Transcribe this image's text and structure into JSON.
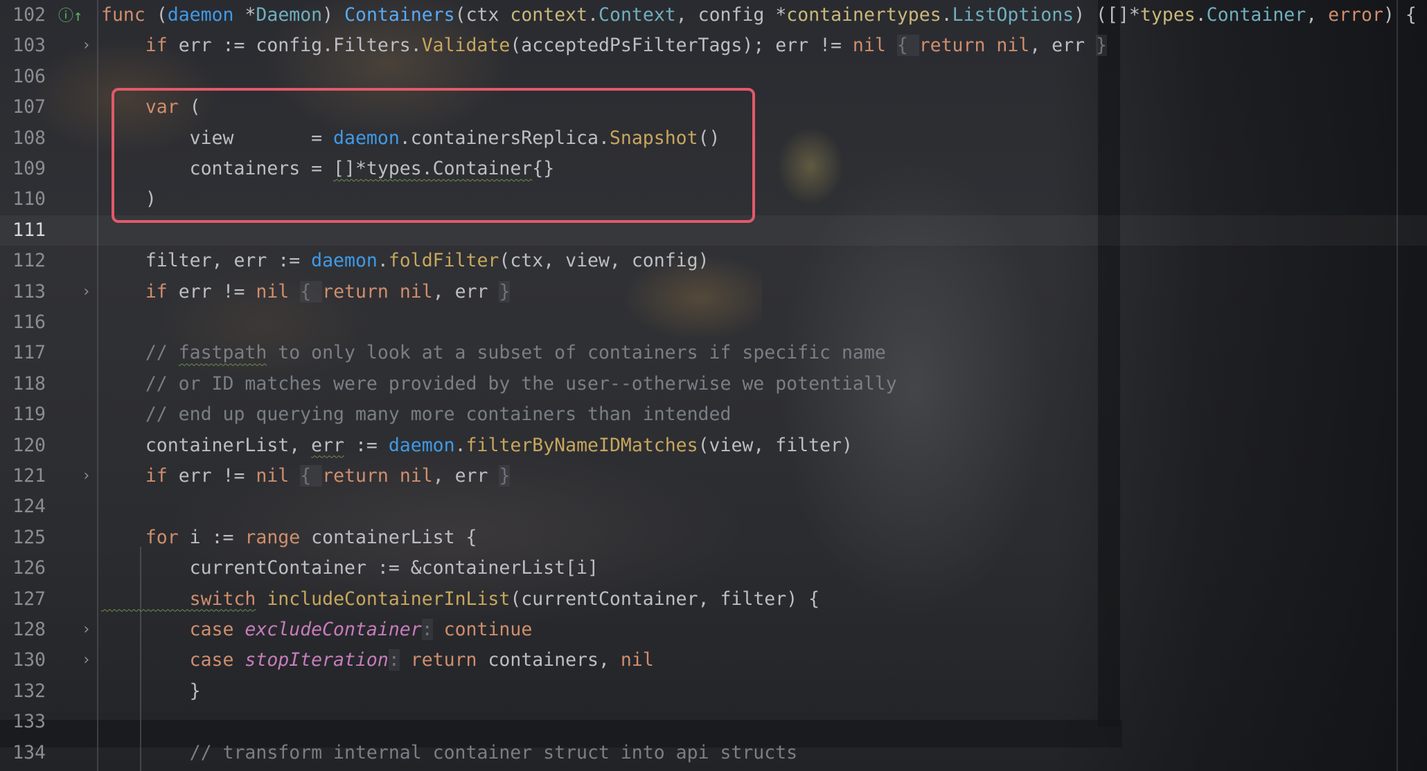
{
  "editor": {
    "language": "Go",
    "highlight_color": "#e15a6a",
    "gutter_icon": "implements-interface-icon",
    "lines": [
      {
        "number": "102",
        "current": false,
        "fold": false,
        "icon": true
      },
      {
        "number": "103",
        "current": false,
        "fold": true
      },
      {
        "number": "106",
        "current": false,
        "fold": false
      },
      {
        "number": "107",
        "current": false,
        "fold": false
      },
      {
        "number": "108",
        "current": false,
        "fold": false
      },
      {
        "number": "109",
        "current": false,
        "fold": false
      },
      {
        "number": "110",
        "current": false,
        "fold": false
      },
      {
        "number": "111",
        "current": true,
        "fold": false
      },
      {
        "number": "112",
        "current": false,
        "fold": false
      },
      {
        "number": "113",
        "current": false,
        "fold": true
      },
      {
        "number": "116",
        "current": false,
        "fold": false
      },
      {
        "number": "117",
        "current": false,
        "fold": false
      },
      {
        "number": "118",
        "current": false,
        "fold": false
      },
      {
        "number": "119",
        "current": false,
        "fold": false
      },
      {
        "number": "120",
        "current": false,
        "fold": false
      },
      {
        "number": "121",
        "current": false,
        "fold": true
      },
      {
        "number": "124",
        "current": false,
        "fold": false
      },
      {
        "number": "125",
        "current": false,
        "fold": false
      },
      {
        "number": "126",
        "current": false,
        "fold": false
      },
      {
        "number": "127",
        "current": false,
        "fold": false
      },
      {
        "number": "128",
        "current": false,
        "fold": true
      },
      {
        "number": "130",
        "current": false,
        "fold": true
      },
      {
        "number": "132",
        "current": false,
        "fold": false
      },
      {
        "number": "133",
        "current": false,
        "fold": false
      },
      {
        "number": "134",
        "current": false,
        "fold": false
      }
    ]
  },
  "code": {
    "l102": [
      [
        "kw",
        "func "
      ],
      [
        "paren",
        "("
      ],
      [
        "recv",
        "daemon"
      ],
      [
        "paren",
        " *"
      ],
      [
        "type",
        "Daemon"
      ],
      [
        "paren",
        ") "
      ],
      [
        "fn",
        "Containers"
      ],
      [
        "paren",
        "(ctx "
      ],
      [
        "ctype",
        "context"
      ],
      [
        "paren",
        "."
      ],
      [
        "type",
        "Context"
      ],
      [
        "paren",
        ", config *"
      ],
      [
        "ctype",
        "containertypes"
      ],
      [
        "paren",
        "."
      ],
      [
        "type",
        "ListOptions"
      ],
      [
        "paren",
        ") ([]*"
      ],
      [
        "ctype",
        "types"
      ],
      [
        "paren",
        "."
      ],
      [
        "type",
        "Container"
      ],
      [
        "paren",
        ", "
      ],
      [
        "kw",
        "error"
      ],
      [
        "paren",
        ") {"
      ]
    ],
    "l103": [
      [
        "kw",
        "    if "
      ],
      [
        "paren",
        "err := config.Filters."
      ],
      [
        "method",
        "Validate"
      ],
      [
        "paren",
        "(acceptedPsFilterTags); err != "
      ],
      [
        "nil",
        "nil"
      ],
      [
        "paren",
        " "
      ],
      [
        "fold-brace",
        "{ "
      ],
      [
        "kw",
        "return "
      ],
      [
        "nil",
        "nil"
      ],
      [
        "paren",
        ", err "
      ],
      [
        "fold-brace",
        "}"
      ]
    ],
    "l106": [],
    "l107": [
      [
        "kw",
        "    var "
      ],
      [
        "paren",
        "("
      ]
    ],
    "l108": [
      [
        "paren",
        "        view       = "
      ],
      [
        "recv",
        "daemon"
      ],
      [
        "paren",
        ".containersReplica."
      ],
      [
        "method",
        "Snapshot"
      ],
      [
        "paren",
        "()"
      ]
    ],
    "l109": [
      [
        "paren",
        "        containers = "
      ],
      [
        "typo",
        "[]*types.Container"
      ],
      [
        "paren",
        "{}"
      ]
    ],
    "l110": [
      [
        "paren",
        "    )"
      ]
    ],
    "l111": [],
    "l112": [
      [
        "paren",
        "    filter, err := "
      ],
      [
        "recv",
        "daemon"
      ],
      [
        "paren",
        "."
      ],
      [
        "method",
        "foldFilter"
      ],
      [
        "paren",
        "(ctx, view, config)"
      ]
    ],
    "l113": [
      [
        "kw",
        "    if "
      ],
      [
        "paren",
        "err != "
      ],
      [
        "nil",
        "nil"
      ],
      [
        "paren",
        " "
      ],
      [
        "fold-brace",
        "{ "
      ],
      [
        "kw",
        "return "
      ],
      [
        "nil",
        "nil"
      ],
      [
        "paren",
        ", err "
      ],
      [
        "fold-brace",
        "}"
      ]
    ],
    "l116": [],
    "l117": [
      [
        "comment",
        "    // "
      ],
      [
        "comment typo",
        "fastpath"
      ],
      [
        "comment",
        " to only look at a subset of containers if specific name"
      ]
    ],
    "l118": [
      [
        "comment",
        "    // or ID matches were provided by the user--otherwise we potentially"
      ]
    ],
    "l119": [
      [
        "comment",
        "    // end up querying many more containers than intended"
      ]
    ],
    "l120": [
      [
        "paren",
        "    containerList, "
      ],
      [
        "typo",
        "err"
      ],
      [
        "paren",
        " := "
      ],
      [
        "recv",
        "daemon"
      ],
      [
        "paren",
        "."
      ],
      [
        "method",
        "filterByNameIDMatches"
      ],
      [
        "paren",
        "(view, filter)"
      ]
    ],
    "l121": [
      [
        "kw",
        "    if "
      ],
      [
        "paren",
        "err != "
      ],
      [
        "nil",
        "nil"
      ],
      [
        "paren",
        " "
      ],
      [
        "fold-brace",
        "{ "
      ],
      [
        "kw",
        "return "
      ],
      [
        "nil",
        "nil"
      ],
      [
        "paren",
        ", err "
      ],
      [
        "fold-brace",
        "}"
      ]
    ],
    "l124": [],
    "l125": [
      [
        "kw",
        "    for "
      ],
      [
        "paren",
        "i := "
      ],
      [
        "kw",
        "range "
      ],
      [
        "paren",
        "containerList {"
      ]
    ],
    "l126": [
      [
        "paren",
        "        currentContainer := &containerList[i]"
      ]
    ],
    "l127": [
      [
        "kw typo",
        "        switch"
      ],
      [
        "paren",
        " "
      ],
      [
        "method",
        "includeContainerInList"
      ],
      [
        "paren",
        "(currentContainer, filter) {"
      ]
    ],
    "l128": [
      [
        "kw",
        "        case "
      ],
      [
        "const",
        "excludeContainer"
      ],
      [
        "fold-brace",
        ":"
      ],
      [
        "paren",
        " "
      ],
      [
        "kw",
        "continue"
      ]
    ],
    "l130": [
      [
        "kw",
        "        case "
      ],
      [
        "const",
        "stopIteration"
      ],
      [
        "fold-brace",
        ":"
      ],
      [
        "paren",
        " "
      ],
      [
        "kw",
        "return "
      ],
      [
        "paren",
        "containers, "
      ],
      [
        "nil",
        "nil"
      ]
    ],
    "l132": [
      [
        "paren",
        "        }"
      ]
    ],
    "l133": [],
    "l134": [
      [
        "comment",
        "        // transform internal container struct into api structs"
      ]
    ]
  }
}
